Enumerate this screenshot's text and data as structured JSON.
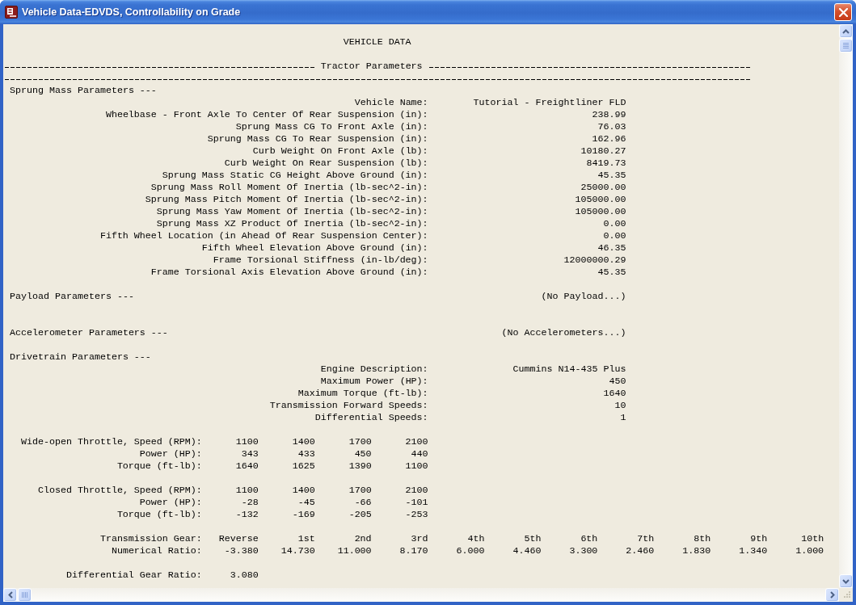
{
  "window": {
    "title": "Vehicle Data-EDVDS, Controllability on Grade"
  },
  "report": {
    "heading": "VEHICLE DATA",
    "section": "Tractor Parameters",
    "groups": [
      {
        "title": "Sprung Mass Parameters ---",
        "fields": [
          {
            "label": "Vehicle Name:",
            "value": "Tutorial - Freightliner FLD"
          },
          {
            "label": "Wheelbase - Front Axle To Center Of Rear Suspension (in):",
            "value": "238.99"
          },
          {
            "label": "Sprung Mass CG To Front Axle (in):",
            "value": "76.03"
          },
          {
            "label": "Sprung Mass CG To Rear Suspension (in):",
            "value": "162.96"
          },
          {
            "label": "Curb Weight On Front Axle (lb):",
            "value": "10180.27"
          },
          {
            "label": "Curb Weight On Rear Suspension (lb):",
            "value": "8419.73"
          },
          {
            "label": "Sprung Mass Static CG Height Above Ground (in):",
            "value": "45.35"
          },
          {
            "label": "Sprung Mass Roll Moment Of Inertia (lb-sec^2-in):",
            "value": "25000.00"
          },
          {
            "label": "Sprung Mass Pitch Moment Of Inertia (lb-sec^2-in):",
            "value": "105000.00"
          },
          {
            "label": "Sprung Mass Yaw Moment Of Inertia (lb-sec^2-in):",
            "value": "105000.00"
          },
          {
            "label": "Sprung Mass XZ Product Of Inertia (lb-sec^2-in):",
            "value": "0.00"
          },
          {
            "label": "Fifth Wheel Location (in Ahead Of Rear Suspension Center):",
            "value": "0.00"
          },
          {
            "label": "Fifth Wheel Elevation Above Ground (in):",
            "value": "46.35"
          },
          {
            "label": "Frame Torsional Stiffness (in-lb/deg):",
            "value": "12000000.29"
          },
          {
            "label": "Frame Torsional Axis Elevation Above Ground (in):",
            "value": "45.35"
          }
        ]
      },
      {
        "title": "Payload Parameters ---",
        "note": "(No Payload...)"
      },
      {
        "title": "Accelerometer Parameters ---",
        "note": "(No Accelerometers...)"
      },
      {
        "title": "Drivetrain Parameters ---",
        "fields": [
          {
            "label": "Engine Description:",
            "value": "Cummins N14-435 Plus"
          },
          {
            "label": "Maximum Power (HP):",
            "value": "450"
          },
          {
            "label": "Maximum Torque (ft-lb):",
            "value": "1640"
          },
          {
            "label": "Transmission Forward Speeds:",
            "value": "10"
          },
          {
            "label": "Differential Speeds:",
            "value": "1"
          }
        ]
      }
    ],
    "tables": [
      {
        "rows": [
          {
            "label": "Wide-open Throttle, Speed (RPM):",
            "values": [
              "1100",
              "1400",
              "1700",
              "2100"
            ]
          },
          {
            "label": "Power (HP):",
            "values": [
              "343",
              "433",
              "450",
              "440"
            ]
          },
          {
            "label": "Torque (ft-lb):",
            "values": [
              "1640",
              "1625",
              "1390",
              "1100"
            ]
          }
        ]
      },
      {
        "rows": [
          {
            "label": "Closed Throttle, Speed (RPM):",
            "values": [
              "1100",
              "1400",
              "1700",
              "2100"
            ]
          },
          {
            "label": "Power (HP):",
            "values": [
              "-28",
              "-45",
              "-66",
              "-101"
            ]
          },
          {
            "label": "Torque (ft-lb):",
            "values": [
              "-132",
              "-169",
              "-205",
              "-253"
            ]
          }
        ]
      },
      {
        "rows": [
          {
            "label": "Transmission Gear:",
            "values": [
              "Reverse",
              "1st",
              "2nd",
              "3rd",
              "4th",
              "5th",
              "6th",
              "7th",
              "8th",
              "9th",
              "10th"
            ]
          },
          {
            "label": "Numerical Ratio:",
            "values": [
              "-3.380",
              "14.730",
              "11.000",
              "8.170",
              "6.000",
              "4.460",
              "3.300",
              "2.460",
              "1.830",
              "1.340",
              "1.000"
            ]
          }
        ]
      },
      {
        "rows": [
          {
            "label": "Differential Gear Ratio:",
            "values": [
              "3.080"
            ]
          }
        ]
      }
    ]
  }
}
